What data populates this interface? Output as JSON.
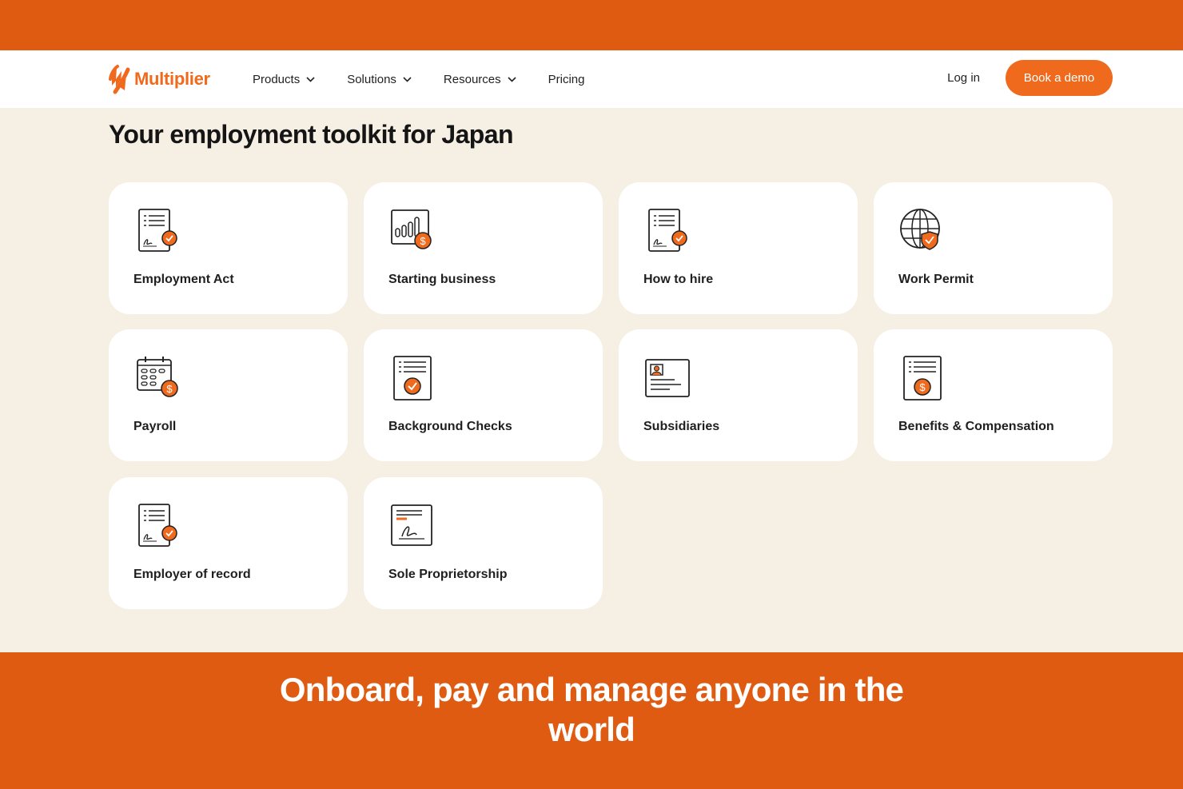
{
  "brand": {
    "name": "Multiplier",
    "accent": "#ef6a1c",
    "band": "#df5b12"
  },
  "nav": {
    "items": [
      {
        "label": "Products",
        "has_dropdown": true
      },
      {
        "label": "Solutions",
        "has_dropdown": true
      },
      {
        "label": "Resources",
        "has_dropdown": true
      },
      {
        "label": "Pricing",
        "has_dropdown": false
      }
    ],
    "login_label": "Log in",
    "cta_label": "Book a demo"
  },
  "main": {
    "title": "Your employment toolkit for Japan",
    "cards": [
      {
        "label": "Employment Act",
        "icon": "signed-document-check-icon"
      },
      {
        "label": "Starting business",
        "icon": "bar-chart-dollar-icon"
      },
      {
        "label": "How to hire",
        "icon": "signed-document-check-icon"
      },
      {
        "label": "Work Permit",
        "icon": "globe-shield-icon"
      },
      {
        "label": "Payroll",
        "icon": "calendar-dollar-icon"
      },
      {
        "label": "Background Checks",
        "icon": "checklist-check-icon"
      },
      {
        "label": "Subsidiaries",
        "icon": "id-card-icon"
      },
      {
        "label": "Benefits & Compensation",
        "icon": "document-dollar-icon"
      },
      {
        "label": "Employer of record",
        "icon": "signed-document-check-icon"
      },
      {
        "label": "Sole Proprietorship",
        "icon": "signature-document-icon"
      }
    ]
  },
  "footer": {
    "headline": "Onboard, pay and manage anyone in the world"
  }
}
